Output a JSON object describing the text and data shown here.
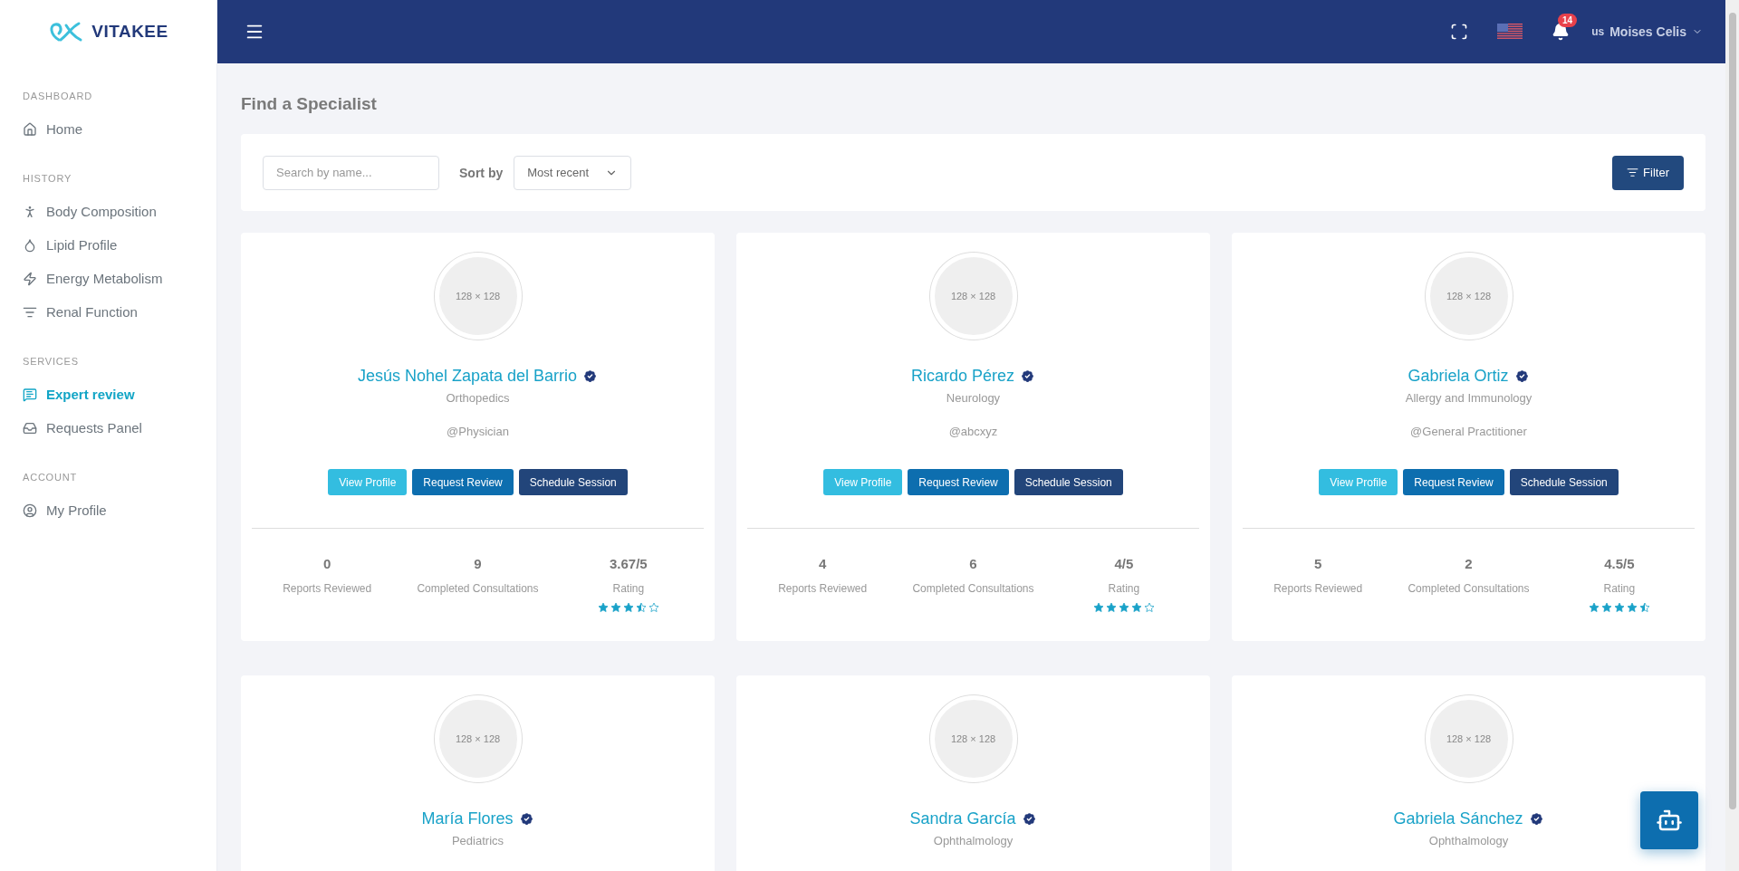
{
  "brand": {
    "name": "VITAKEE"
  },
  "sidebar": {
    "sections": [
      {
        "title": "DASHBOARD",
        "items": [
          {
            "label": "Home",
            "selected": false
          }
        ]
      },
      {
        "title": "HISTORY",
        "items": [
          {
            "label": "Body Composition",
            "selected": false
          },
          {
            "label": "Lipid Profile",
            "selected": false
          },
          {
            "label": "Energy Metabolism",
            "selected": false
          },
          {
            "label": "Renal Function",
            "selected": false
          }
        ]
      },
      {
        "title": "SERVICES",
        "items": [
          {
            "label": "Expert review",
            "selected": true
          },
          {
            "label": "Requests Panel",
            "selected": false
          }
        ]
      },
      {
        "title": "ACCOUNT",
        "items": [
          {
            "label": "My Profile",
            "selected": false
          }
        ]
      }
    ]
  },
  "header": {
    "notification_count": "14",
    "user_avatar_alt": "us",
    "user_name": "Moises Celis"
  },
  "page_title": "Find a Specialist",
  "toolbar": {
    "search_placeholder": "Search by name...",
    "sort_label": "Sort by",
    "sort_value": "Most recent",
    "filter_button": "Filter"
  },
  "specialists": [
    {
      "avatar_text": "128 × 128",
      "name": "Jesús Nohel Zapata del Barrio",
      "verified": true,
      "specialty": "Orthopedics",
      "handle": "@Physician",
      "buttons": [
        "View Profile",
        "Request Review",
        "Schedule Session"
      ],
      "stats": [
        {
          "value": "0",
          "label": "Reports Reviewed"
        },
        {
          "value": "9",
          "label": "Completed Consultations"
        },
        {
          "value": "3.67/5",
          "label": "Rating",
          "stars": 3.5
        }
      ]
    },
    {
      "avatar_text": "128 × 128",
      "name": "Ricardo Pérez",
      "verified": true,
      "specialty": "Neurology",
      "handle": "@abcxyz",
      "buttons": [
        "View Profile",
        "Request Review",
        "Schedule Session"
      ],
      "stats": [
        {
          "value": "4",
          "label": "Reports Reviewed"
        },
        {
          "value": "6",
          "label": "Completed Consultations"
        },
        {
          "value": "4/5",
          "label": "Rating",
          "stars": 4
        }
      ]
    },
    {
      "avatar_text": "128 × 128",
      "name": "Gabriela Ortiz",
      "verified": true,
      "specialty": "Allergy and Immunology",
      "handle": "@General Practitioner",
      "buttons": [
        "View Profile",
        "Request Review",
        "Schedule Session"
      ],
      "stats": [
        {
          "value": "5",
          "label": "Reports Reviewed"
        },
        {
          "value": "2",
          "label": "Completed Consultations"
        },
        {
          "value": "4.5/5",
          "label": "Rating",
          "stars": 4.5
        }
      ]
    },
    {
      "avatar_text": "128 × 128",
      "name": "María Flores",
      "verified": true,
      "specialty": "Pediatrics"
    },
    {
      "avatar_text": "128 × 128",
      "name": "Sandra García",
      "verified": true,
      "specialty": "Ophthalmology"
    },
    {
      "avatar_text": "128 × 128",
      "name": "Gabriela Sánchez",
      "verified": true,
      "specialty": "Ophthalmology"
    }
  ]
}
